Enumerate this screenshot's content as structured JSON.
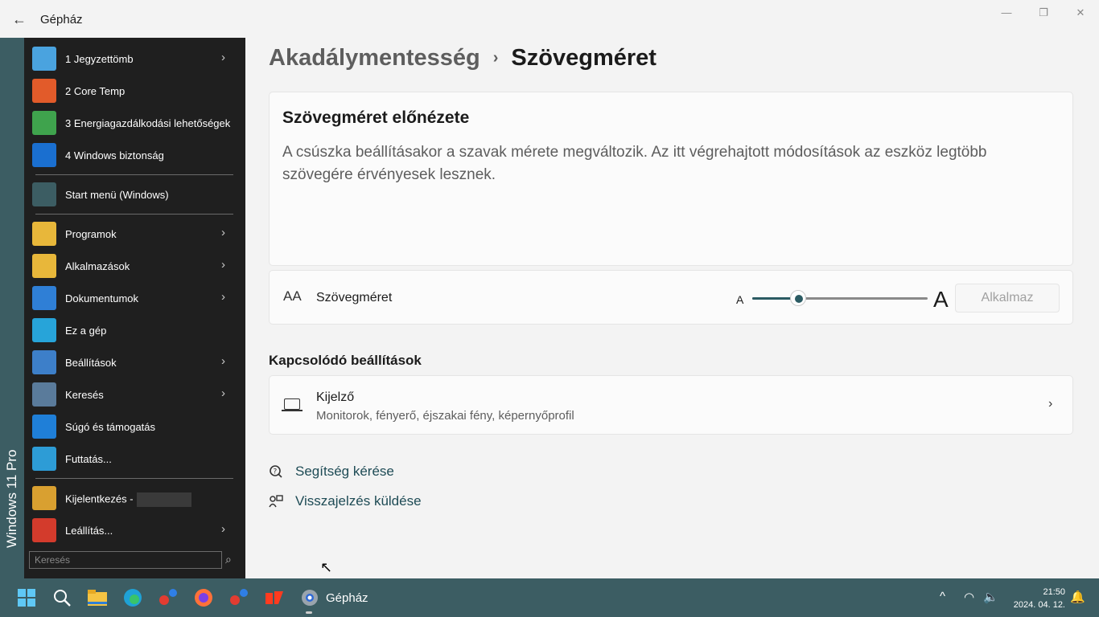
{
  "window": {
    "title": "Gépház",
    "back_icon": "←",
    "minimize_icon": "—",
    "maximize_icon": "❐",
    "close_icon": "✕"
  },
  "breadcrumb": {
    "parent": "Akadálymentesség",
    "separator": "›",
    "current": "Szövegméret"
  },
  "preview": {
    "title": "Szövegméret előnézete",
    "text": "A csúszka beállításakor a szavak mérete megváltozik. Az itt végrehajtott módosítások az eszköz legtöbb szövegére érvényesek lesznek."
  },
  "text_size": {
    "icon": "text-size-icon",
    "icon_glyph": "AA",
    "label": "Szövegméret",
    "small_a": "A",
    "big_a": "A",
    "slider_fraction": 0.26,
    "apply_label": "Alkalmaz"
  },
  "related": {
    "heading": "Kapcsolódó beállítások",
    "display_title": "Kijelző",
    "display_subtitle": "Monitorok, fényerő, éjszakai fény, képernyőprofil",
    "chevron": "›"
  },
  "links": {
    "help": "Segítség kérése",
    "feedback": "Visszajelzés küldése"
  },
  "start_menu": {
    "edition": "Windows 11 Pro",
    "items": [
      {
        "label": "1 Jegyzettömb",
        "icon": "notepad-icon",
        "color": "#4aa3df",
        "arrow": true
      },
      {
        "label": "2 Core Temp",
        "icon": "thermometer-icon",
        "color": "#e25b2a",
        "arrow": false
      },
      {
        "label": "3 Energiagazdálkodási lehetőségek",
        "icon": "battery-icon",
        "color": "#3fa34d",
        "arrow": false
      },
      {
        "label": "4 Windows biztonság",
        "icon": "shield-icon",
        "color": "#1a6fd0",
        "arrow": false
      },
      {
        "label": "Start menü (Windows)",
        "icon": "start-menu-icon",
        "color": "#3c5d63",
        "arrow": false
      },
      {
        "label": "Programok",
        "icon": "programs-icon",
        "color": "#e8b73a",
        "arrow": true
      },
      {
        "label": "Alkalmazások",
        "icon": "apps-icon",
        "color": "#e8b73a",
        "arrow": true
      },
      {
        "label": "Dokumentumok",
        "icon": "documents-icon",
        "color": "#2f7fd6",
        "arrow": true
      },
      {
        "label": "Ez a gép",
        "icon": "computer-icon",
        "color": "#27a4d9",
        "arrow": false
      },
      {
        "label": "Beállítások",
        "icon": "settings-icon",
        "color": "#3d7fc9",
        "arrow": true
      },
      {
        "label": "Keresés",
        "icon": "search-icon",
        "color": "#5a7b9b",
        "arrow": true
      },
      {
        "label": "Súgó és támogatás",
        "icon": "help-icon",
        "color": "#1f7fd8",
        "arrow": false
      },
      {
        "label": "Futtatás...",
        "icon": "run-icon",
        "color": "#2d9cd6",
        "arrow": false
      },
      {
        "label": "Kijelentkezés -",
        "icon": "key-icon",
        "color": "#d9a030",
        "arrow": false
      },
      {
        "label": "Leállítás...",
        "icon": "power-icon",
        "color": "#d33b2c",
        "arrow": true
      }
    ],
    "arrow_glyph": "›",
    "search_placeholder": "Keresés",
    "search_icon_glyph": "⌕"
  },
  "taskbar": {
    "active_label": "Gépház",
    "time": "21:50",
    "date": "2024. 04. 12.",
    "tray_chevron": "^",
    "wifi_glyph": "◠",
    "volume_glyph": "🔈",
    "notification_glyph": "🔔",
    "icons": [
      "windows-start-icon",
      "search-icon",
      "file-explorer-icon",
      "edge-icon",
      "app-icon",
      "firefox-icon",
      "app-icon",
      "app-icon",
      "settings-icon"
    ]
  }
}
